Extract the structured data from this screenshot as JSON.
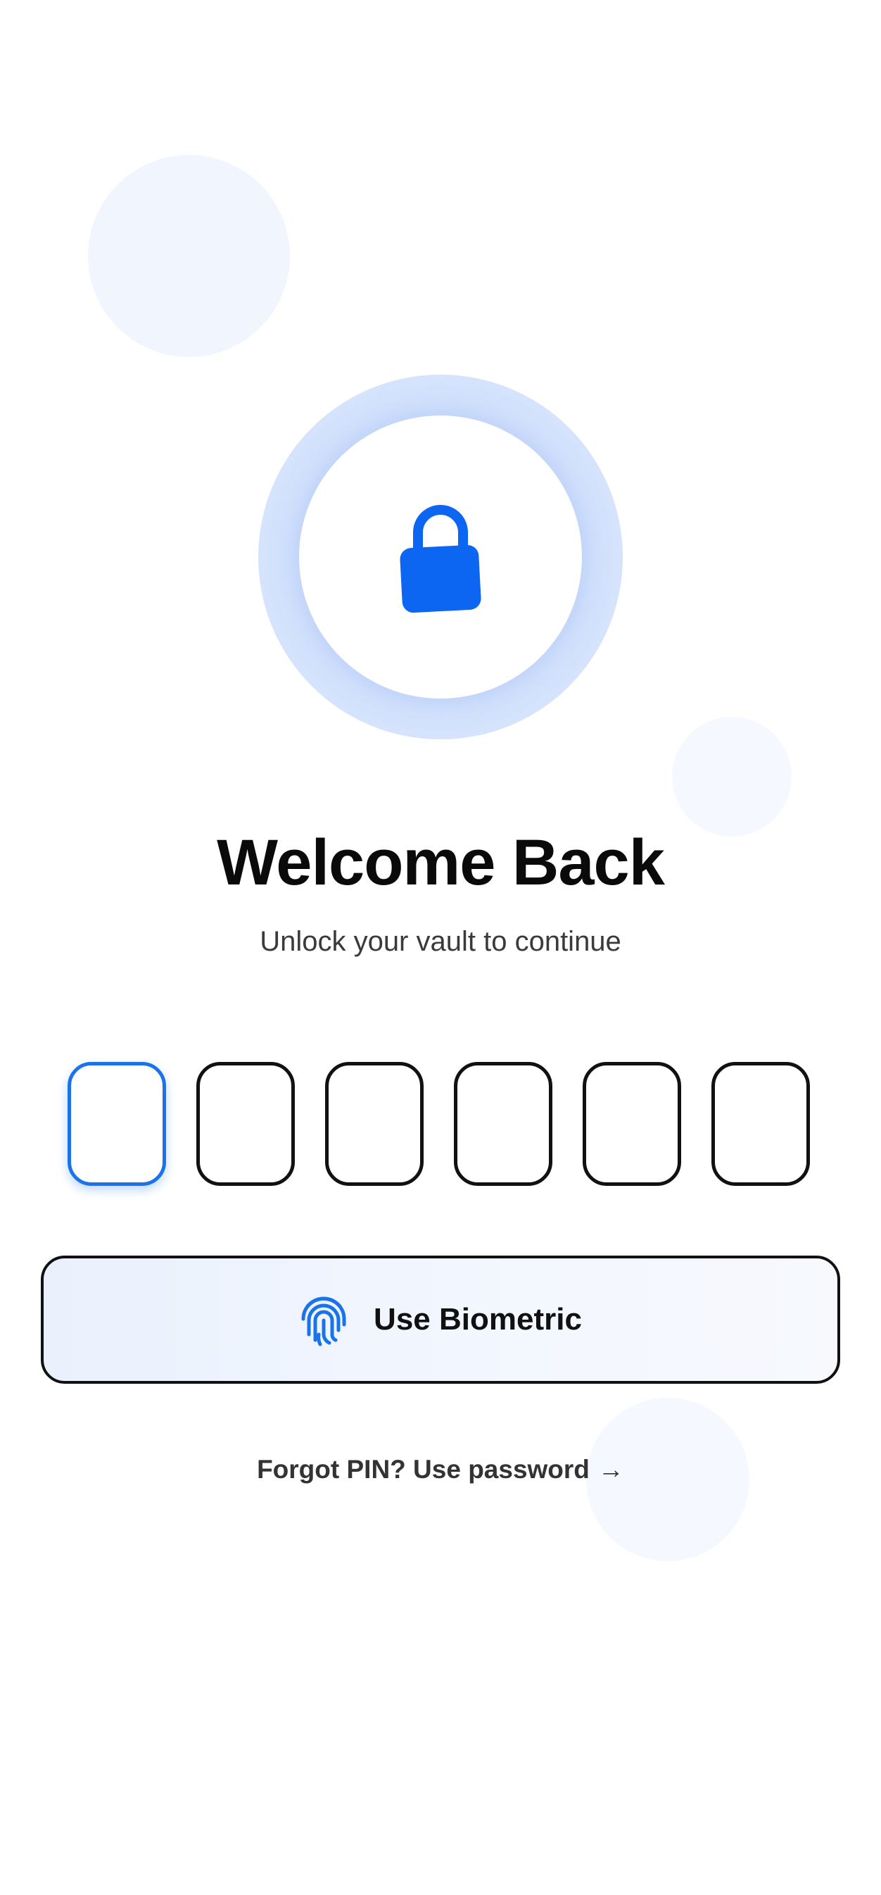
{
  "header": {
    "title": "Welcome Back",
    "subtitle": "Unlock your vault to continue"
  },
  "pin": {
    "length": 6,
    "filled": 0,
    "active_index": 0
  },
  "biometric_button": {
    "label": "Use Biometric",
    "icon": "fingerprint-icon"
  },
  "forgot_link": {
    "label": "Forgot PIN? Use password",
    "arrow": "→"
  },
  "icons": {
    "hero": "lock-icon"
  },
  "colors": {
    "accent": "#1a73e8",
    "lock": "#0d66f2",
    "text": "#0a0a0a"
  }
}
